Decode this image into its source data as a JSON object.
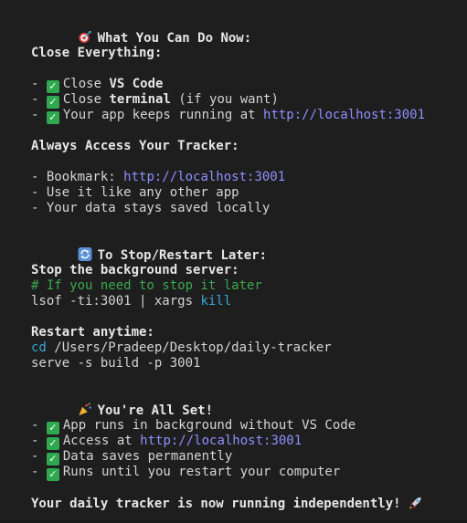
{
  "colors": {
    "background": "#1e1e1e",
    "text": "#d4d4d4",
    "link": "#8f8fff",
    "comment": "#3ba64f",
    "keyword": "#3aa6d8",
    "check": "#2fa84f"
  },
  "sections": {
    "what_you_can_do": {
      "icon": "target-icon",
      "title": "What You Can Do Now:"
    },
    "close_everything": {
      "title": "Close Everything:",
      "items": [
        {
          "pre": "Close ",
          "bold": "VS Code",
          "post": ""
        },
        {
          "pre": "Close ",
          "bold": "terminal",
          "post": " (if you want)"
        },
        {
          "pre": "Your app keeps running at ",
          "link": "http://localhost:3001"
        }
      ]
    },
    "always_access": {
      "title": "Always Access Your Tracker:",
      "items": [
        {
          "pre": "Bookmark: ",
          "link": "http://localhost:3001"
        },
        {
          "text": "Use it like any other app"
        },
        {
          "text": "Your data stays saved locally"
        }
      ]
    },
    "stop_restart": {
      "icon": "cycle-icon",
      "title": "To Stop/Restart Later:"
    },
    "stop_server": {
      "title": "Stop the background server:",
      "comment": "# If you need to stop it later",
      "command_pre": "lsof -ti:3001 | xargs ",
      "command_kw": "kill"
    },
    "restart": {
      "title": "Restart anytime:",
      "cd_kw": "cd",
      "cd_path": " /Users/Pradeep/Desktop/daily-tracker",
      "serve_cmd": "serve -s build -p 3001"
    },
    "all_set": {
      "icon": "party-popper-icon",
      "title": "You're All Set!",
      "items": [
        {
          "text": "App runs in background without VS Code"
        },
        {
          "pre": "Access at ",
          "link": "http://localhost:3001"
        },
        {
          "text": "Data saves permanently"
        },
        {
          "text": "Runs until you restart your computer"
        }
      ]
    },
    "final": {
      "text": "Your daily tracker is now running independently!",
      "icon": "rocket-icon"
    }
  },
  "bullet": "- "
}
